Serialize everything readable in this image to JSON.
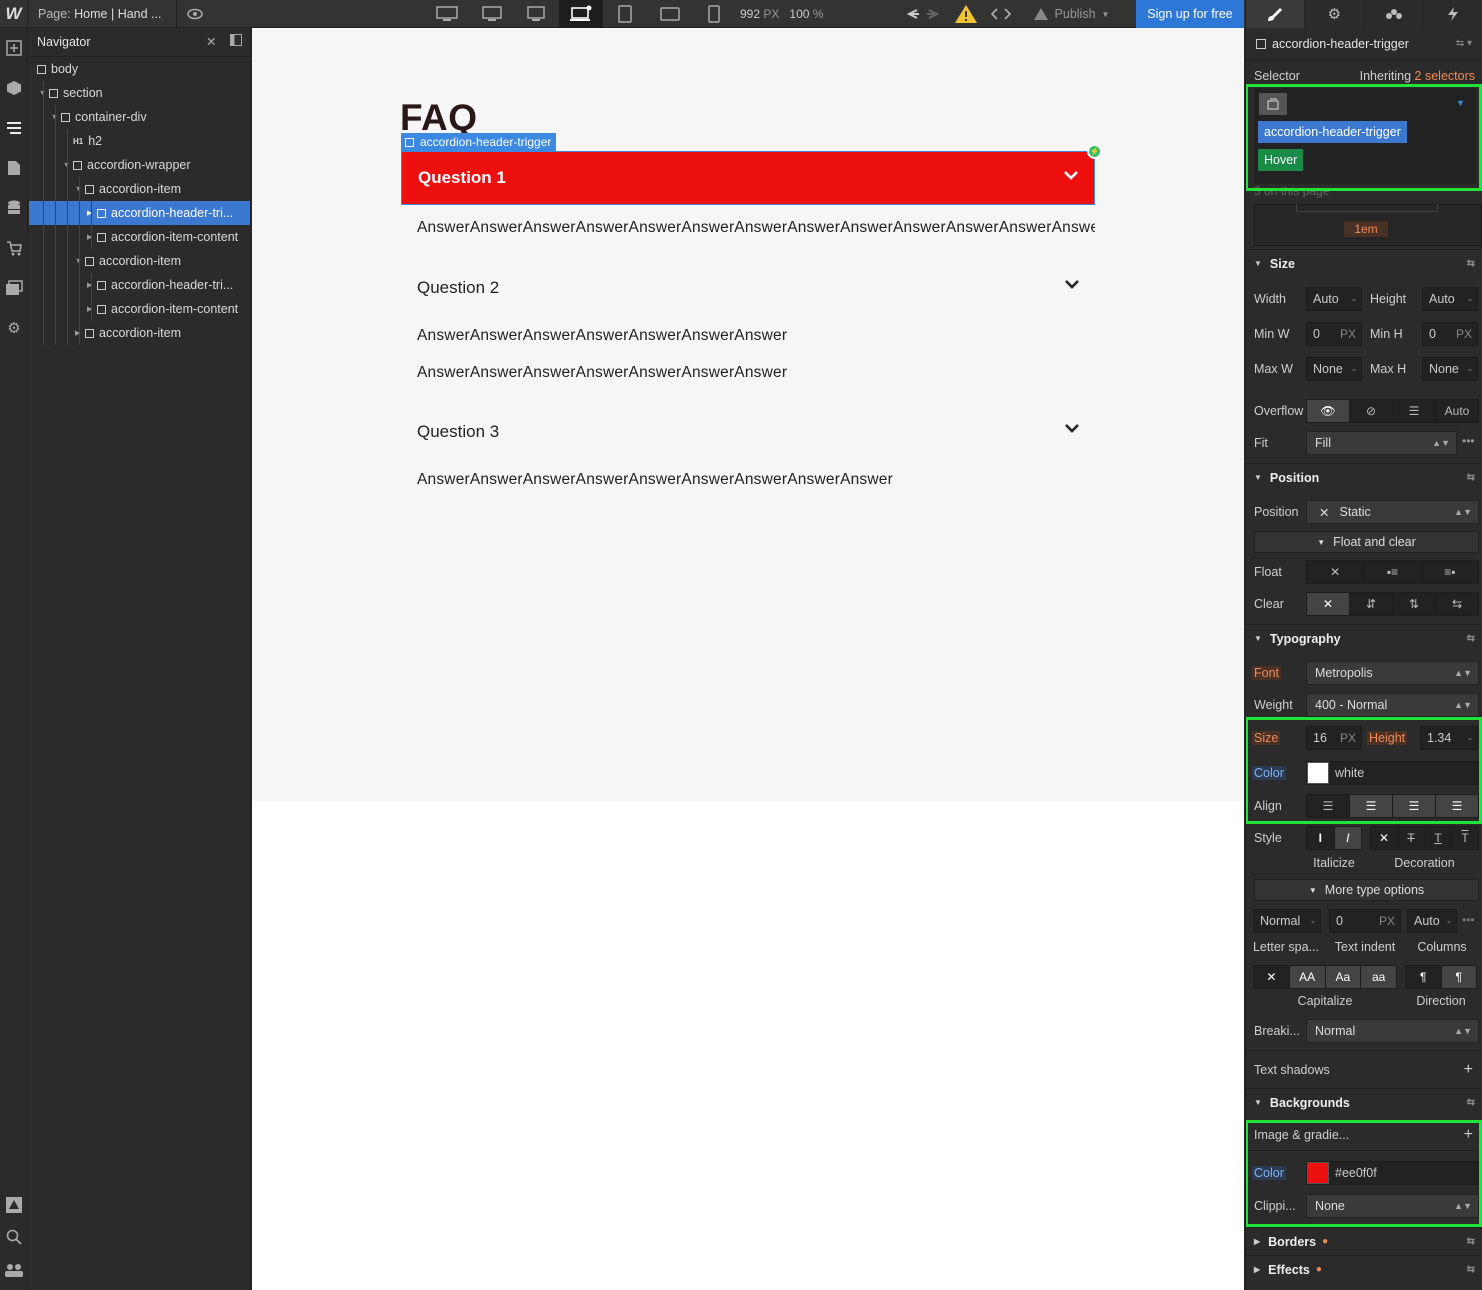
{
  "topbar": {
    "logo": "W",
    "page_prefix": "Page:",
    "page_name": "Home | Hand ...",
    "width_value": "992",
    "width_unit": "PX",
    "zoom_value": "100",
    "zoom_unit": "%",
    "publish_label": "Publish",
    "signup_label": "Sign up for free"
  },
  "navigator": {
    "title": "Navigator",
    "items": [
      {
        "label": "body",
        "depth": 0
      },
      {
        "label": "section",
        "depth": 1
      },
      {
        "label": "container-div",
        "depth": 2
      },
      {
        "label": "h2",
        "depth": 3,
        "tag": "H1"
      },
      {
        "label": "accordion-wrapper",
        "depth": 3
      },
      {
        "label": "accordion-item",
        "depth": 4
      },
      {
        "label": "accordion-header-tri...",
        "depth": 5,
        "selected": true
      },
      {
        "label": "accordion-item-content",
        "depth": 5
      },
      {
        "label": "accordion-item",
        "depth": 4
      },
      {
        "label": "accordion-header-tri...",
        "depth": 5
      },
      {
        "label": "accordion-item-content",
        "depth": 5
      },
      {
        "label": "accordion-item",
        "depth": 4
      }
    ]
  },
  "canvas": {
    "faq_title": "FAQ",
    "selected_tag": "accordion-header-trigger",
    "questions": [
      "Question 1",
      "Question 2",
      "Question 3"
    ],
    "answers": [
      "AnswerAnswerAnswerAnswerAnswerAnswerAnswerAnswerAnswerAnswerAnswerAnswerAnswerAnsw",
      "AnswerAnswerAnswerAnswerAnswerAnswerAnswer",
      "AnswerAnswerAnswerAnswerAnswerAnswerAnswer",
      "AnswerAnswerAnswerAnswerAnswerAnswerAnswerAnswerAnswer"
    ],
    "header_bg_color": "#ee0f0f"
  },
  "panel": {
    "element_name": "accordion-header-trigger",
    "selector_label": "Selector",
    "inheriting_label": "Inheriting",
    "inheriting_count": "2 selectors",
    "class_chip": "accordion-header-trigger",
    "state_chip": "Hover",
    "on_page_hint": "3 on this page",
    "spacing_value": "1em",
    "size": {
      "title": "Size",
      "width_label": "Width",
      "width_value": "Auto",
      "height_label": "Height",
      "height_value": "Auto",
      "minw_label": "Min W",
      "minw_value": "0",
      "minw_unit": "PX",
      "minh_label": "Min H",
      "minh_value": "0",
      "minh_unit": "PX",
      "maxw_label": "Max W",
      "maxw_value": "None",
      "maxh_label": "Max H",
      "maxh_value": "None",
      "overflow_label": "Overflow",
      "overflow_auto": "Auto",
      "fit_label": "Fit",
      "fit_value": "Fill"
    },
    "position": {
      "title": "Position",
      "position_label": "Position",
      "position_value": "Static",
      "float_clear": "Float and clear",
      "float_label": "Float",
      "clear_label": "Clear"
    },
    "typography": {
      "title": "Typography",
      "font_label": "Font",
      "font_value": "Metropolis",
      "weight_label": "Weight",
      "weight_value": "400 - Normal",
      "size_label": "Size",
      "size_value": "16",
      "size_unit": "PX",
      "height_label": "Height",
      "height_value": "1.34",
      "color_label": "Color",
      "color_value": "white",
      "color_hex": "#ffffff",
      "align_label": "Align",
      "style_label": "Style",
      "italicize_label": "Italicize",
      "decoration_label": "Decoration",
      "more_options": "More type options",
      "letter_spacing_value": "Normal",
      "text_indent_value": "0",
      "text_indent_unit": "PX",
      "columns_value": "Auto",
      "letter_spacing_label": "Letter spa...",
      "text_indent_label": "Text indent",
      "columns_label": "Columns",
      "cap_aa": "AA",
      "cap_Aa": "Aa",
      "cap_aa_lower": "aa",
      "capitalize_label": "Capitalize",
      "direction_label": "Direction",
      "breaking_label": "Breaki...",
      "breaking_value": "Normal",
      "text_shadows_label": "Text shadows"
    },
    "backgrounds": {
      "title": "Backgrounds",
      "image_gradient_label": "Image & gradie...",
      "color_label": "Color",
      "color_value": "#ee0f0f",
      "color_hex": "#ee0f0f",
      "clipping_label": "Clippi...",
      "clipping_value": "None"
    },
    "borders_title": "Borders",
    "effects_title": "Effects"
  }
}
